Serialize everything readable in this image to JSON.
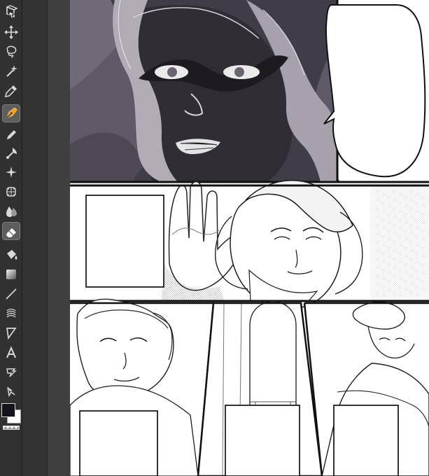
{
  "app": {
    "name": "",
    "document_title": "",
    "zoom": ""
  },
  "toolbar": {
    "tools": [
      {
        "name": "object-select-tool",
        "icon": "cursor-cube-icon",
        "active": false
      },
      {
        "name": "move-tool",
        "icon": "move-arrows-icon",
        "active": false
      },
      {
        "name": "lasso-tool",
        "icon": "lasso-icon",
        "active": false
      },
      {
        "name": "magic-wand-tool",
        "icon": "magic-wand-icon",
        "active": false
      },
      {
        "name": "eyedropper-tool",
        "icon": "eyedropper-icon",
        "active": false
      },
      {
        "name": "pen-tool",
        "icon": "pen-nib-icon",
        "active": true
      },
      {
        "name": "pencil-tool",
        "icon": "pencil-icon",
        "active": false
      },
      {
        "name": "brush-tool",
        "icon": "brush-icon",
        "active": false
      },
      {
        "name": "decoration-tool",
        "icon": "sparkle-icon",
        "active": false
      },
      {
        "name": "airbrush-tool",
        "icon": "airbrush-icon",
        "active": false
      },
      {
        "name": "blend-tool",
        "icon": "blend-drop-icon",
        "active": false
      },
      {
        "name": "eraser-tool",
        "icon": "eraser-icon",
        "active": false
      },
      {
        "name": "fill-tool",
        "icon": "bucket-icon",
        "active": false
      },
      {
        "name": "gradient-tool",
        "icon": "gradient-icon",
        "active": false
      },
      {
        "name": "line-tool",
        "icon": "line-icon",
        "active": false
      },
      {
        "name": "frame-tool",
        "icon": "frame-icon",
        "active": false
      },
      {
        "name": "ruler-tool",
        "icon": "ruler-icon",
        "active": false
      },
      {
        "name": "text-tool",
        "icon": "text-icon",
        "active": false
      },
      {
        "name": "balloon-tool",
        "icon": "balloon-icon",
        "active": false
      },
      {
        "name": "correction-tool",
        "icon": "correct-line-icon",
        "active": false
      }
    ],
    "sub_tools": [
      {
        "name": "sub-tool-top",
        "icon": "link-icon"
      },
      {
        "name": "sub-tool-canvas",
        "icon": "canvas-icon"
      },
      {
        "name": "sub-tool-cube",
        "icon": "cube-icon"
      },
      {
        "name": "sub-tool-layers",
        "icon": "layers-icon"
      },
      {
        "name": "sub-tool-grid",
        "icon": "grid-icon"
      }
    ],
    "colors": {
      "foreground": "#15121c",
      "background": "#ffffff",
      "transparent_swatch": "checkerboard"
    }
  },
  "manga_page": {
    "panels": [
      {
        "name": "villain-closeup",
        "text": ""
      },
      {
        "name": "hand-and-sweat",
        "text": ""
      },
      {
        "name": "older-man",
        "text": ""
      },
      {
        "name": "corridor",
        "text": ""
      },
      {
        "name": "woman-with-hat",
        "text": ""
      }
    ],
    "text_boxes": [
      {
        "name": "speech-bubble-top-right",
        "text": ""
      },
      {
        "name": "caption-box-mid-left",
        "text": ""
      },
      {
        "name": "caption-box-bottom-left",
        "text": ""
      },
      {
        "name": "caption-box-bottom-center",
        "text": ""
      },
      {
        "name": "caption-box-bottom-right",
        "text": ""
      }
    ]
  }
}
